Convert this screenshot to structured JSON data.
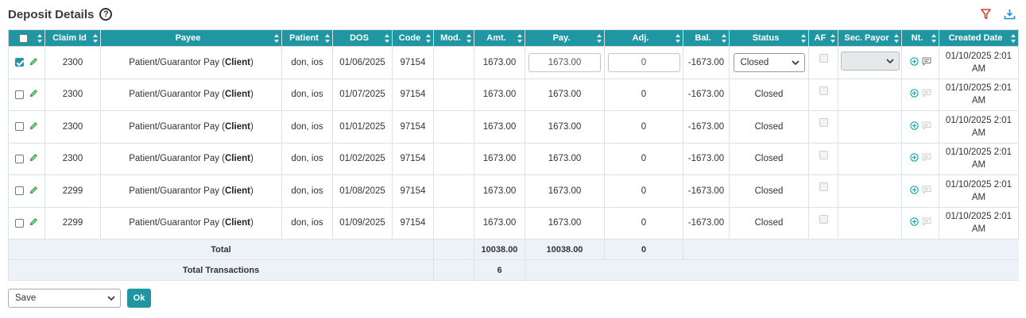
{
  "header": {
    "title": "Deposit Details",
    "help_glyph": "?"
  },
  "colors": {
    "accent": "#2196a3",
    "filter": "#e53935",
    "download": "#1e88c7",
    "pencil": "#2e9e46"
  },
  "columns": [
    "Claim Id",
    "Payee",
    "Patient",
    "DOS",
    "Code",
    "Mod.",
    "Amt.",
    "Pay.",
    "Adj.",
    "Bal.",
    "Status",
    "AF",
    "Sec. Payor",
    "Nt.",
    "Created Date"
  ],
  "rows": [
    {
      "claim_id": "2300",
      "payee_text": "Patient/Guarantor Pay (",
      "payee_bold": "Client",
      "payee_end": ")",
      "patient": "don, ios",
      "dos": "01/06/2025",
      "code": "97154",
      "mod": "",
      "amt": "1673.00",
      "pay": "1673.00",
      "adj": "0",
      "bal": "-1673.00",
      "status": "Closed",
      "created_1": "01/10/2025 2:01",
      "created_2": "AM"
    },
    {
      "claim_id": "2300",
      "payee_text": "Patient/Guarantor Pay (",
      "payee_bold": "Client",
      "payee_end": ")",
      "patient": "don, ios",
      "dos": "01/07/2025",
      "code": "97154",
      "mod": "",
      "amt": "1673.00",
      "pay": "1673.00",
      "adj": "0",
      "bal": "-1673.00",
      "status": "Closed",
      "created_1": "01/10/2025 2:01",
      "created_2": "AM"
    },
    {
      "claim_id": "2300",
      "payee_text": "Patient/Guarantor Pay (",
      "payee_bold": "Client",
      "payee_end": ")",
      "patient": "don, ios",
      "dos": "01/01/2025",
      "code": "97154",
      "mod": "",
      "amt": "1673.00",
      "pay": "1673.00",
      "adj": "0",
      "bal": "-1673.00",
      "status": "Closed",
      "created_1": "01/10/2025 2:01",
      "created_2": "AM"
    },
    {
      "claim_id": "2300",
      "payee_text": "Patient/Guarantor Pay (",
      "payee_bold": "Client",
      "payee_end": ")",
      "patient": "don, ios",
      "dos": "01/02/2025",
      "code": "97154",
      "mod": "",
      "amt": "1673.00",
      "pay": "1673.00",
      "adj": "0",
      "bal": "-1673.00",
      "status": "Closed",
      "created_1": "01/10/2025 2:01",
      "created_2": "AM"
    },
    {
      "claim_id": "2299",
      "payee_text": "Patient/Guarantor Pay (",
      "payee_bold": "Client",
      "payee_end": ")",
      "patient": "don, ios",
      "dos": "01/08/2025",
      "code": "97154",
      "mod": "",
      "amt": "1673.00",
      "pay": "1673.00",
      "adj": "0",
      "bal": "-1673.00",
      "status": "Closed",
      "created_1": "01/10/2025 2:01",
      "created_2": "AM"
    },
    {
      "claim_id": "2299",
      "payee_text": "Patient/Guarantor Pay (",
      "payee_bold": "Client",
      "payee_end": ")",
      "patient": "don, ios",
      "dos": "01/09/2025",
      "code": "97154",
      "mod": "",
      "amt": "1673.00",
      "pay": "1673.00",
      "adj": "0",
      "bal": "-1673.00",
      "status": "Closed",
      "created_1": "01/10/2025 2:01",
      "created_2": "AM"
    }
  ],
  "totals": {
    "label": "Total",
    "amt": "10038.00",
    "pay": "10038.00",
    "adj": "0",
    "transactions_label": "Total Transactions",
    "transactions": "6"
  },
  "footer": {
    "action_selected": "Save",
    "ok_label": "Ok"
  }
}
